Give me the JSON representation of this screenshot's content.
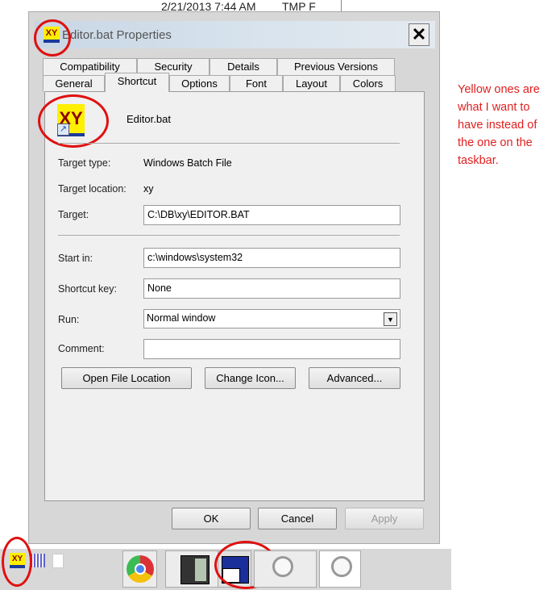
{
  "top_bar": {
    "datetime": "2/21/2013 7:44 AM",
    "label": "TMP F"
  },
  "dialog": {
    "title": "Editor.bat Properties",
    "tabs_row1": [
      "Compatibility",
      "Security",
      "Details",
      "Previous Versions"
    ],
    "tabs_row2": [
      "General",
      "Shortcut",
      "Options",
      "Font",
      "Layout",
      "Colors"
    ],
    "active_tab": "Shortcut",
    "file_name": "Editor.bat",
    "icon_text": "XY",
    "target_type_label": "Target type:",
    "target_type": "Windows Batch File",
    "target_location_label": "Target location:",
    "target_location": "xy",
    "target_label": "Target:",
    "target": "C:\\DB\\xy\\EDITOR.BAT",
    "start_in_label": "Start in:",
    "start_in": "c:\\windows\\system32",
    "shortcut_key_label": "Shortcut key:",
    "shortcut_key": "None",
    "run_label": "Run:",
    "run": "Normal window",
    "comment_label": "Comment:",
    "comment": "",
    "open_file_location": "Open File Location",
    "change_icon": "Change Icon...",
    "advanced": "Advanced...",
    "ok": "OK",
    "cancel": "Cancel",
    "apply": "Apply"
  },
  "annotation": "Yellow ones are what I want to have instead of  the one on the taskbar.",
  "annotation_color": "#e02020",
  "taskbar": {
    "icons": [
      "xy-icon",
      "grid-icon",
      "document-icon",
      "chrome-icon",
      "calculator-icon",
      "command-prompt-icon",
      "magnifier-icon",
      "magnifier-icon"
    ]
  }
}
